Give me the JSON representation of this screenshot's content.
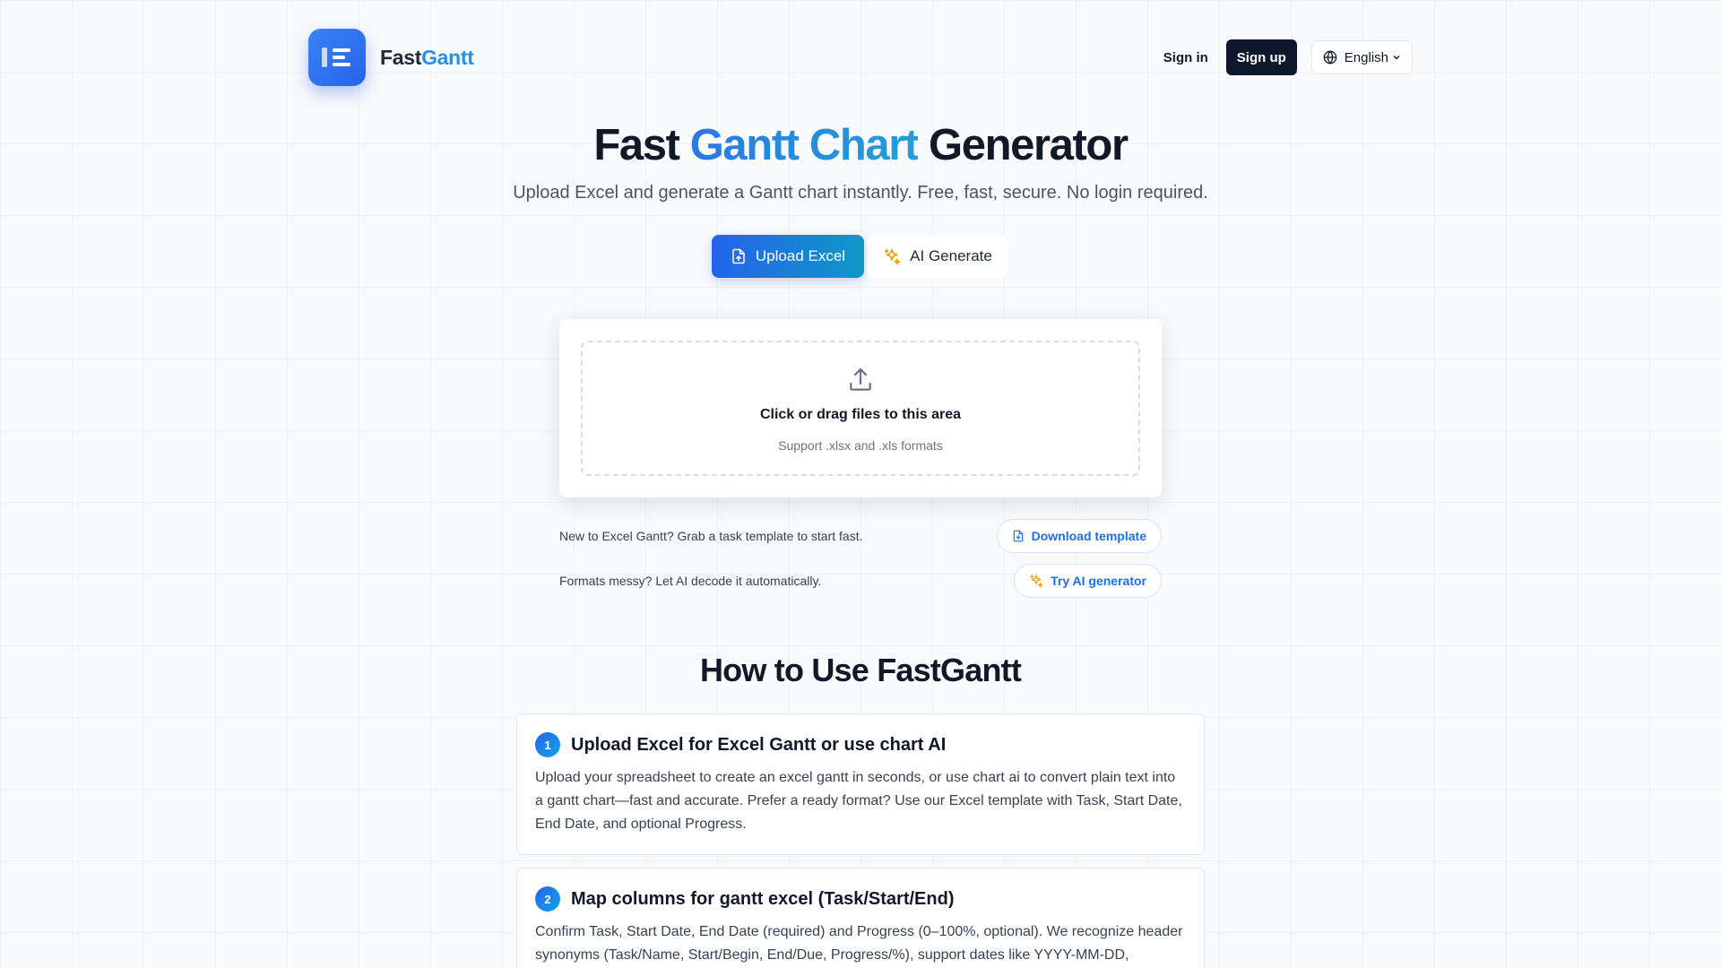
{
  "brand": {
    "name_part1": "Fast",
    "name_part2": "Gantt",
    "logo_icon": "gantt-logo-icon",
    "accent": "#2563eb"
  },
  "nav": {
    "sign_in": "Sign in",
    "sign_up": "Sign up",
    "language": "English"
  },
  "hero": {
    "title_part1": "Fast ",
    "title_part2": "Gantt Chart",
    "title_part3": " Generator",
    "subtitle": "Upload Excel and generate a Gantt chart instantly. Free, fast, secure. No login required."
  },
  "tabs": {
    "upload": "Upload Excel",
    "ai": "AI Generate",
    "active": "upload"
  },
  "upload": {
    "title": "Click or drag files to this area",
    "hint": "Support .xlsx and .xls formats"
  },
  "helpers": [
    {
      "text": "New to Excel Gantt? Grab a task template to start fast.",
      "button": "Download template",
      "icon": "file-download-icon"
    },
    {
      "text": "Formats messy? Let AI decode it automatically.",
      "button": "Try AI generator",
      "icon": "sparkles-icon"
    }
  ],
  "how_to": {
    "title": "How to Use FastGantt",
    "steps": [
      {
        "num": "1",
        "title": "Upload Excel for Excel Gantt or use chart AI",
        "body": "Upload your spreadsheet to create an excel gantt in seconds, or use chart ai to convert plain text into a gantt chart—fast and accurate. Prefer a ready format? Use our Excel template with Task, Start Date, End Date, and optional Progress."
      },
      {
        "num": "2",
        "title": "Map columns for gantt excel (Task/Start/End)",
        "body": "Confirm Task, Start Date, End Date (required) and Progress (0–100%, optional). We recognize header synonyms (Task/Name, Start/Begin, End/Due, Progress/%), support dates like YYYY-MM-DD,"
      }
    ]
  }
}
